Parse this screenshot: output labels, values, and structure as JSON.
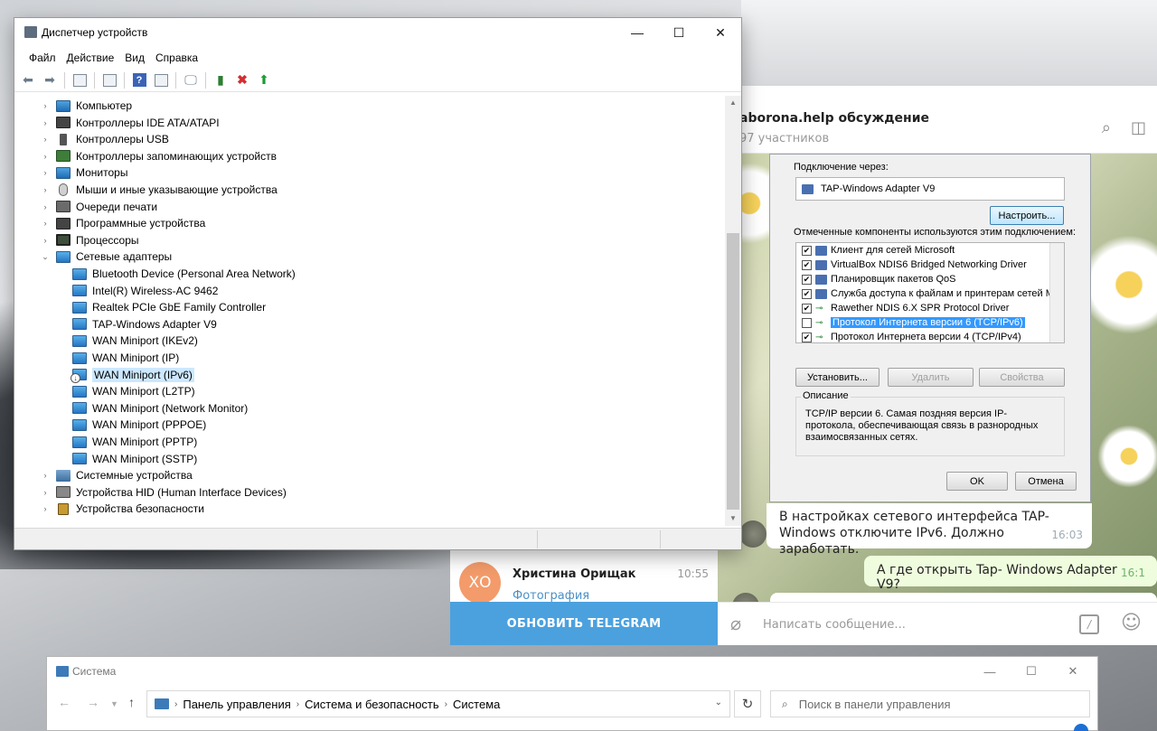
{
  "device_manager": {
    "title": "Диспетчер устройств",
    "menu": [
      "Файл",
      "Действие",
      "Вид",
      "Справка"
    ],
    "tree": [
      {
        "label": "Компьютер",
        "icon": "monitor-icon",
        "expanded": false,
        "level": 0
      },
      {
        "label": "Контроллеры IDE ATA/ATAPI",
        "icon": "ide-controller-icon",
        "expanded": false,
        "level": 0
      },
      {
        "label": "Контроллеры USB",
        "icon": "usb-icon",
        "expanded": false,
        "level": 0
      },
      {
        "label": "Контроллеры запоминающих устройств",
        "icon": "storage-controller-icon",
        "expanded": false,
        "level": 0
      },
      {
        "label": "Мониторы",
        "icon": "monitor-icon",
        "expanded": false,
        "level": 0
      },
      {
        "label": "Мыши и иные указывающие устройства",
        "icon": "mouse-icon",
        "expanded": false,
        "level": 0
      },
      {
        "label": "Очереди печати",
        "icon": "printer-icon",
        "expanded": false,
        "level": 0
      },
      {
        "label": "Программные устройства",
        "icon": "software-device-icon",
        "expanded": false,
        "level": 0
      },
      {
        "label": "Процессоры",
        "icon": "processor-icon",
        "expanded": false,
        "level": 0
      },
      {
        "label": "Сетевые адаптеры",
        "icon": "network-adapter-icon",
        "expanded": true,
        "level": 0
      },
      {
        "label": "Bluetooth Device (Personal Area Network)",
        "icon": "network-adapter-icon",
        "level": 1
      },
      {
        "label": "Intel(R) Wireless-AC 9462",
        "icon": "network-adapter-icon",
        "level": 1
      },
      {
        "label": "Realtek PCIe GbE Family Controller",
        "icon": "network-adapter-icon",
        "level": 1
      },
      {
        "label": "TAP-Windows Adapter V9",
        "icon": "network-adapter-icon",
        "level": 1
      },
      {
        "label": "WAN Miniport (IKEv2)",
        "icon": "network-adapter-icon",
        "level": 1
      },
      {
        "label": "WAN Miniport (IP)",
        "icon": "network-adapter-icon",
        "level": 1
      },
      {
        "label": "WAN Miniport (IPv6)",
        "icon": "network-adapter-disabled-icon",
        "level": 1,
        "selected": true
      },
      {
        "label": "WAN Miniport (L2TP)",
        "icon": "network-adapter-icon",
        "level": 1
      },
      {
        "label": "WAN Miniport (Network Monitor)",
        "icon": "network-adapter-icon",
        "level": 1
      },
      {
        "label": "WAN Miniport (PPPOE)",
        "icon": "network-adapter-icon",
        "level": 1
      },
      {
        "label": "WAN Miniport (PPTP)",
        "icon": "network-adapter-icon",
        "level": 1
      },
      {
        "label": "WAN Miniport (SSTP)",
        "icon": "network-adapter-icon",
        "level": 1
      },
      {
        "label": "Системные устройства",
        "icon": "system-device-icon",
        "expanded": false,
        "level": 0
      },
      {
        "label": "Устройства HID (Human Interface Devices)",
        "icon": "hid-icon",
        "expanded": false,
        "level": 0
      },
      {
        "label": "Устройства безопасности",
        "icon": "security-device-icon",
        "expanded": false,
        "level": 0
      }
    ]
  },
  "telegram": {
    "chat_title": "aborona.help обсуждение",
    "chat_subtitle": "97 участников",
    "shared_screenshot": {
      "connect_via_label": "Подключение через:",
      "adapter_name": "TAP-Windows Adapter V9",
      "configure_button": "Настроить...",
      "components_label": "Отмеченные компоненты используются этим подключением:",
      "components": [
        {
          "label": "Клиент для сетей Microsoft",
          "checked": true,
          "kind": "client"
        },
        {
          "label": "VirtualBox NDIS6 Bridged Networking Driver",
          "checked": true,
          "kind": "service"
        },
        {
          "label": "Планировщик пакетов QoS",
          "checked": true,
          "kind": "service"
        },
        {
          "label": "Служба доступа к файлам и принтерам сетей Micro",
          "checked": true,
          "kind": "service"
        },
        {
          "label": "Rawether NDIS 6.X SPR Protocol Driver",
          "checked": true,
          "kind": "protocol"
        },
        {
          "label": "Протокол Интернета версии 6 (TCP/IPv6)",
          "checked": false,
          "kind": "protocol",
          "selected": true
        },
        {
          "label": "Протокол Интернета версии 4 (TCP/IPv4)",
          "checked": true,
          "kind": "protocol"
        }
      ],
      "install_button": "Установить...",
      "remove_button": "Удалить",
      "properties_button": "Свойства",
      "description_title": "Описание",
      "description_text": "TCP/IP версии 6. Самая поздняя версия IP-протокола, обеспечивающая связь в разнородных взаимосвязанных сетях.",
      "ok_button": "OK",
      "cancel_button": "Отмена"
    },
    "message_in": {
      "text": "В настройках сетевого интерфейса TAP-Windows отключите IPv6. Должно заработать.",
      "time": "16:03"
    },
    "message_out": {
      "text": "А где открыть Tap- Windows Adapter V9?",
      "time": "16:1"
    },
    "contact": {
      "initials": "ХО",
      "name": "Христина Орищак",
      "time": "10:55",
      "preview": "Фотография"
    },
    "update_button": "ОБНОВИТЬ TELEGRAM",
    "input_placeholder": "Написать сообщение...",
    "cmd_label": "/",
    "accent_color": "#4ba1de"
  },
  "system_window": {
    "title": "Система",
    "breadcrumb": [
      "Панель управления",
      "Система и безопасность",
      "Система"
    ],
    "search_placeholder": "Поиск в панели управления"
  }
}
